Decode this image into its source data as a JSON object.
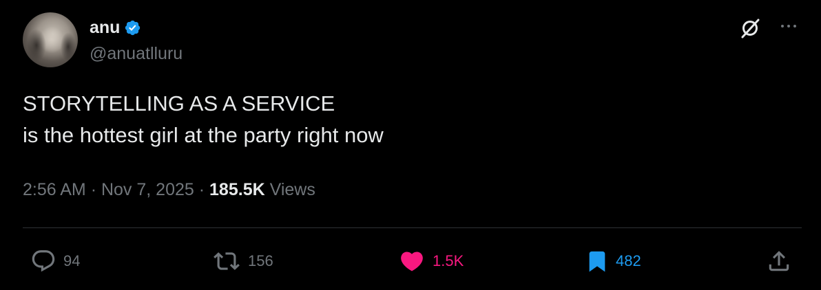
{
  "author": {
    "name": "anu",
    "handle": "@anuatlluru",
    "verified_icon": "verified-badge-icon"
  },
  "tweet": {
    "lines": [
      "STORYTELLING AS A SERVICE",
      "is the hottest girl at the party right now"
    ],
    "time": "2:56 AM",
    "separator": "·",
    "date": "Nov 7, 2025",
    "views_count": "185.5K",
    "views_label": "Views"
  },
  "actions": {
    "replies": "94",
    "retweets": "156",
    "likes": "1.5K",
    "bookmarks": "482"
  },
  "colors": {
    "background": "#000000",
    "text": "#e7e9ea",
    "secondary": "#71767b",
    "verified": "#1d9bf0",
    "like": "#f91880",
    "bookmark": "#1d9bf0",
    "divider": "#2f3336"
  },
  "icons": {
    "grok": "grok-icon",
    "more": "more-options-icon",
    "reply": "reply-icon",
    "retweet": "retweet-icon",
    "like": "heart-icon",
    "bookmark": "bookmark-icon",
    "share": "share-icon"
  }
}
